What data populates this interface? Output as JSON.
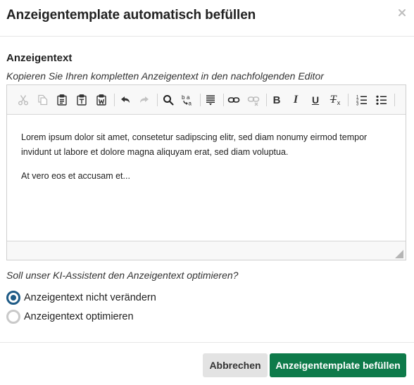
{
  "dialog": {
    "title": "Anzeigentemplate automatisch befüllen",
    "close_icon": "close-icon"
  },
  "section": {
    "title": "Anzeigentext",
    "hint": "Kopieren Sie Ihren kompletten Anzeigentext in den nachfolgenden Editor"
  },
  "editor": {
    "toolbar": [
      {
        "name": "cut-icon",
        "enabled": false
      },
      {
        "name": "copy-icon",
        "enabled": false
      },
      {
        "name": "paste-icon",
        "enabled": true
      },
      {
        "name": "paste-text-icon",
        "enabled": true
      },
      {
        "name": "paste-from-word-icon",
        "enabled": true
      },
      {
        "name": "undo-icon",
        "enabled": true
      },
      {
        "name": "redo-icon",
        "enabled": false
      },
      {
        "name": "find-icon",
        "enabled": true
      },
      {
        "name": "replace-icon",
        "enabled": true
      },
      {
        "name": "select-all-icon",
        "enabled": true
      },
      {
        "name": "link-icon",
        "enabled": true
      },
      {
        "name": "unlink-icon",
        "enabled": false
      },
      {
        "name": "bold-icon",
        "enabled": true
      },
      {
        "name": "italic-icon",
        "enabled": true
      },
      {
        "name": "underline-icon",
        "enabled": true
      },
      {
        "name": "remove-format-icon",
        "enabled": true
      },
      {
        "name": "numbered-list-icon",
        "enabled": true
      },
      {
        "name": "bulleted-list-icon",
        "enabled": true
      }
    ],
    "toolbar_letters": {
      "bold": "B",
      "italic": "I",
      "underline": "U",
      "remove_format": "T"
    },
    "paragraphs": [
      "Lorem ipsum dolor sit amet, consetetur sadipscing elitr, sed diam nonumy eirmod tempor invidunt ut labore et dolore magna aliquyam erat, sed diam voluptua.",
      "At vero eos et accusam et..."
    ]
  },
  "optimize": {
    "question": "Soll unser KI-Assistent den Anzeigentext optimieren?",
    "options": [
      {
        "label": "Anzeigentext nicht verändern",
        "checked": true
      },
      {
        "label": "Anzeigentext optimieren",
        "checked": false
      }
    ]
  },
  "footer": {
    "cancel_label": "Abbrechen",
    "submit_label": "Anzeigentemplate befüllen"
  },
  "colors": {
    "primary": "#0e7a4a",
    "radio_checked": "#1f5b86",
    "cancel_bg": "#e3e3e3"
  }
}
